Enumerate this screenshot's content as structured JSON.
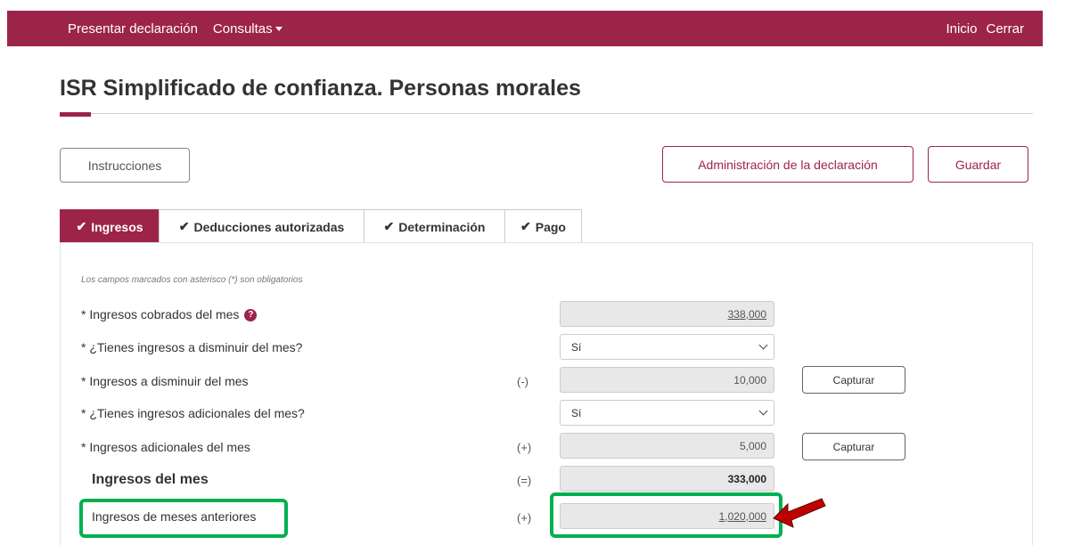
{
  "nav": {
    "items_left": [
      "Presentar declaración",
      "Consultas"
    ],
    "inicio": "Inicio",
    "cerrar": "Cerrar"
  },
  "page_title": "ISR Simplificado de confianza. Personas morales",
  "buttons": {
    "instrucciones": "Instrucciones",
    "administracion": "Administración de la declaración",
    "guardar": "Guardar"
  },
  "tabs": [
    {
      "label": "Ingresos",
      "active": true
    },
    {
      "label": "Deducciones autorizadas",
      "active": false
    },
    {
      "label": "Determinación",
      "active": false
    },
    {
      "label": "Pago",
      "active": false
    }
  ],
  "note": "Los campos marcados con asterisco (*) son obligatorios",
  "rows": [
    {
      "label": "* Ingresos cobrados del mes",
      "op": "",
      "value": "338,000"
    },
    {
      "label": "* ¿Tienes ingresos a disminuir del mes?",
      "op": "",
      "value": "Sí"
    },
    {
      "label": "* Ingresos a disminuir del mes",
      "op": "(-)",
      "value": "10,000",
      "action": "Capturar"
    },
    {
      "label": "* ¿Tienes ingresos adicionales del mes?",
      "op": "",
      "value": "Sí"
    },
    {
      "label": "* Ingresos adicionales del mes",
      "op": "(+)",
      "value": "5,000",
      "action": "Capturar"
    },
    {
      "label": "Ingresos del mes",
      "op": "(=)",
      "value": "333,000"
    },
    {
      "label": "Ingresos de meses anteriores",
      "op": "(+)",
      "value": "1,020,000"
    }
  ],
  "colors": {
    "brand": "#9d2449",
    "highlight": "#00b050",
    "arrow": "#c00000"
  }
}
